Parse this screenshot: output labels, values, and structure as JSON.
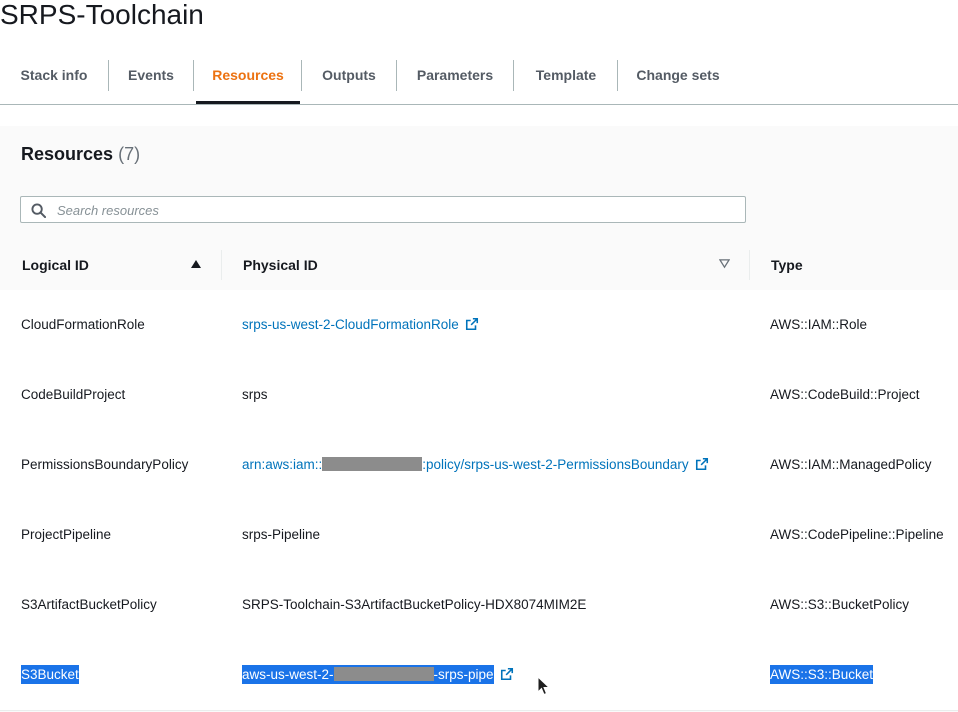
{
  "page": {
    "title": "SRPS-Toolchain"
  },
  "tabs": [
    {
      "label": "Stack info",
      "active": false
    },
    {
      "label": "Events",
      "active": false
    },
    {
      "label": "Resources",
      "active": true
    },
    {
      "label": "Outputs",
      "active": false
    },
    {
      "label": "Parameters",
      "active": false
    },
    {
      "label": "Template",
      "active": false
    },
    {
      "label": "Change sets",
      "active": false
    }
  ],
  "resources": {
    "title": "Resources",
    "count": "(7)",
    "search_placeholder": "Search resources",
    "columns": {
      "logical": "Logical ID",
      "physical": "Physical ID",
      "type": "Type"
    },
    "rows": [
      {
        "logical": "CloudFormationRole",
        "physical": "srps-us-west-2-CloudFormationRole",
        "physical_link": true,
        "type": "AWS::IAM::Role"
      },
      {
        "logical": "CodeBuildProject",
        "physical": "srps",
        "physical_link": false,
        "type": "AWS::CodeBuild::Project"
      },
      {
        "logical": "PermissionsBoundaryPolicy",
        "physical_prefix": "arn:aws:iam::",
        "physical_suffix": ":policy/srps-us-west-2-PermissionsBoundary",
        "physical_link": true,
        "type": "AWS::IAM::ManagedPolicy"
      },
      {
        "logical": "ProjectPipeline",
        "physical": "srps-Pipeline",
        "physical_link": false,
        "type": "AWS::CodePipeline::Pipeline"
      },
      {
        "logical": "S3ArtifactBucketPolicy",
        "physical": "SRPS-Toolchain-S3ArtifactBucketPolicy-HDX8074MIM2E",
        "physical_link": false,
        "type": "AWS::S3::BucketPolicy"
      },
      {
        "logical": "S3Bucket",
        "physical_prefix": "aws-us-west-2-",
        "physical_suffix": "-srps-pipe",
        "physical_link": true,
        "type": "AWS::S3::Bucket",
        "selected": true
      }
    ]
  },
  "colors": {
    "accent": "#ec7211",
    "link": "#0073bb",
    "selection": "#1a73e8"
  }
}
